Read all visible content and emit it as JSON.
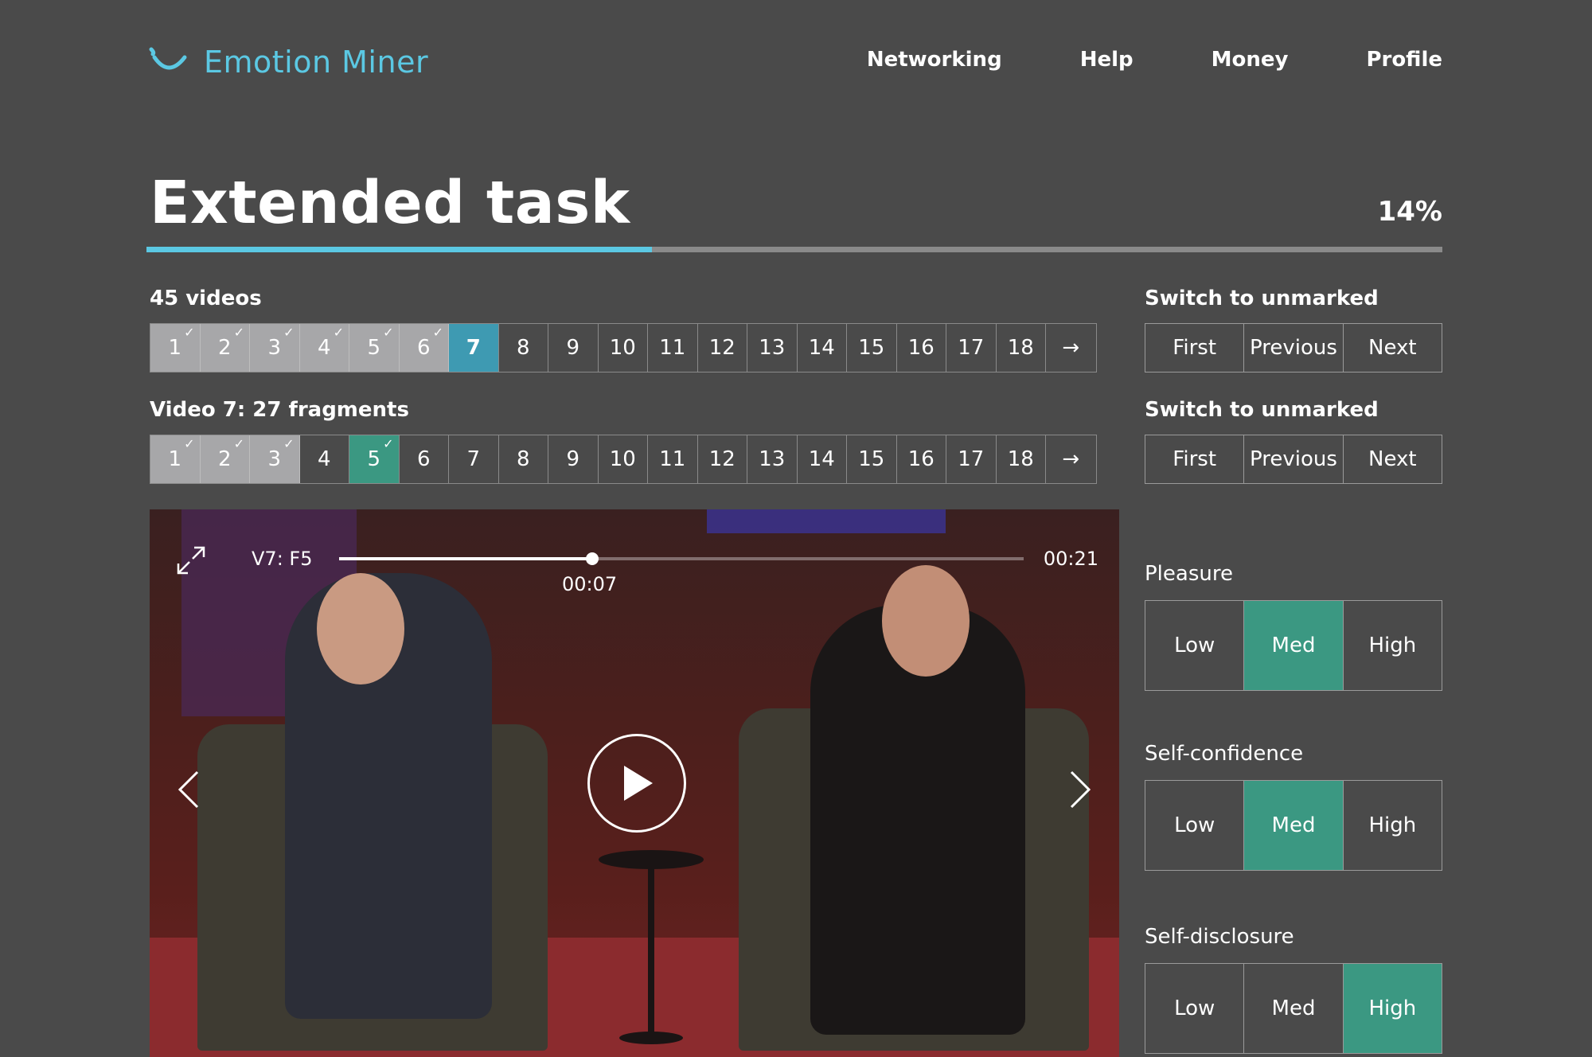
{
  "brand": {
    "name": "Emotion Miner",
    "accent_color": "#5bc8e3"
  },
  "nav": [
    "Networking",
    "Help",
    "Money",
    "Profile"
  ],
  "task": {
    "title": "Extended task",
    "progress_label": "14%",
    "progress_fraction": 0.39
  },
  "videos": {
    "label": "45 videos",
    "cells": [
      {
        "label": "1",
        "state": "done"
      },
      {
        "label": "2",
        "state": "done"
      },
      {
        "label": "3",
        "state": "done"
      },
      {
        "label": "4",
        "state": "done"
      },
      {
        "label": "5",
        "state": "done"
      },
      {
        "label": "6",
        "state": "done"
      },
      {
        "label": "7",
        "state": "active-blue"
      },
      {
        "label": "8",
        "state": ""
      },
      {
        "label": "9",
        "state": ""
      },
      {
        "label": "10",
        "state": ""
      },
      {
        "label": "11",
        "state": ""
      },
      {
        "label": "12",
        "state": ""
      },
      {
        "label": "13",
        "state": ""
      },
      {
        "label": "14",
        "state": ""
      },
      {
        "label": "15",
        "state": ""
      },
      {
        "label": "16",
        "state": ""
      },
      {
        "label": "17",
        "state": ""
      },
      {
        "label": "18",
        "state": ""
      },
      {
        "label": "→",
        "state": "next"
      }
    ],
    "switch": {
      "label": "Switch to unmarked",
      "first": "First",
      "previous": "Previous",
      "next": "Next"
    }
  },
  "fragments": {
    "label": "Video 7: 27 fragments",
    "cells": [
      {
        "label": "1",
        "state": "done"
      },
      {
        "label": "2",
        "state": "done"
      },
      {
        "label": "3",
        "state": "done"
      },
      {
        "label": "4",
        "state": ""
      },
      {
        "label": "5",
        "state": "active-green"
      },
      {
        "label": "6",
        "state": ""
      },
      {
        "label": "7",
        "state": ""
      },
      {
        "label": "8",
        "state": ""
      },
      {
        "label": "9",
        "state": ""
      },
      {
        "label": "10",
        "state": ""
      },
      {
        "label": "11",
        "state": ""
      },
      {
        "label": "12",
        "state": ""
      },
      {
        "label": "13",
        "state": ""
      },
      {
        "label": "14",
        "state": ""
      },
      {
        "label": "15",
        "state": ""
      },
      {
        "label": "16",
        "state": ""
      },
      {
        "label": "17",
        "state": ""
      },
      {
        "label": "18",
        "state": ""
      },
      {
        "label": "→",
        "state": "next"
      }
    ],
    "switch": {
      "label": "Switch to unmarked",
      "first": "First",
      "previous": "Previous",
      "next": "Next"
    }
  },
  "player": {
    "fragment_label": "V7: F5",
    "current_time": "00:07",
    "total_time": "00:21",
    "playback_fraction": 0.37
  },
  "ratings": [
    {
      "label": "Pleasure",
      "options": [
        "Low",
        "Med",
        "High"
      ],
      "selected": "Med"
    },
    {
      "label": "Self-confidence",
      "options": [
        "Low",
        "Med",
        "High"
      ],
      "selected": "Med"
    },
    {
      "label": "Self-disclosure",
      "options": [
        "Low",
        "Med",
        "High"
      ],
      "selected": "High"
    }
  ],
  "colors": {
    "background": "#4a4a4a",
    "done_cell": "#a7a7a9",
    "active_blue": "#3e9ab2",
    "active_green": "#3b9882"
  },
  "icons": {
    "logo": "smile-icon",
    "expand": "expand-icon",
    "play": "play-icon",
    "prev": "chevron-left-icon",
    "next": "chevron-right-icon",
    "check": "check-icon",
    "arrow": "arrow-right-icon"
  }
}
